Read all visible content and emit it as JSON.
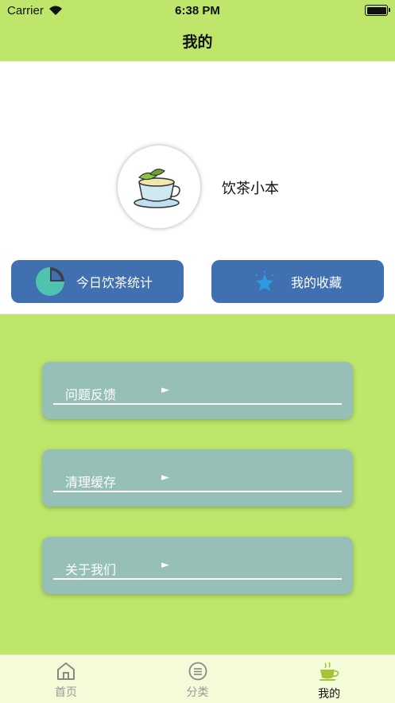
{
  "status_bar": {
    "carrier": "Carrier",
    "time": "6:38 PM"
  },
  "nav": {
    "title": "我的"
  },
  "profile": {
    "name": "饮茶小本"
  },
  "actions": [
    {
      "label": "今日饮茶统计",
      "icon": "pie-chart-icon"
    },
    {
      "label": "我的收藏",
      "icon": "star-icon"
    }
  ],
  "menu": [
    {
      "label": "问题反馈",
      "arrow": "►"
    },
    {
      "label": "清理缓存",
      "arrow": "►"
    },
    {
      "label": "关于我们",
      "arrow": "►"
    }
  ],
  "tabs": [
    {
      "label": "首页",
      "icon": "home-icon",
      "active": false
    },
    {
      "label": "分类",
      "icon": "category-icon",
      "active": false
    },
    {
      "label": "我的",
      "icon": "tea-cup-icon",
      "active": true
    }
  ],
  "colors": {
    "accent_green": "#bde66b",
    "button_blue": "#4070b0",
    "card_teal": "#95bfb7",
    "tab_bg": "#f4fbd9"
  }
}
